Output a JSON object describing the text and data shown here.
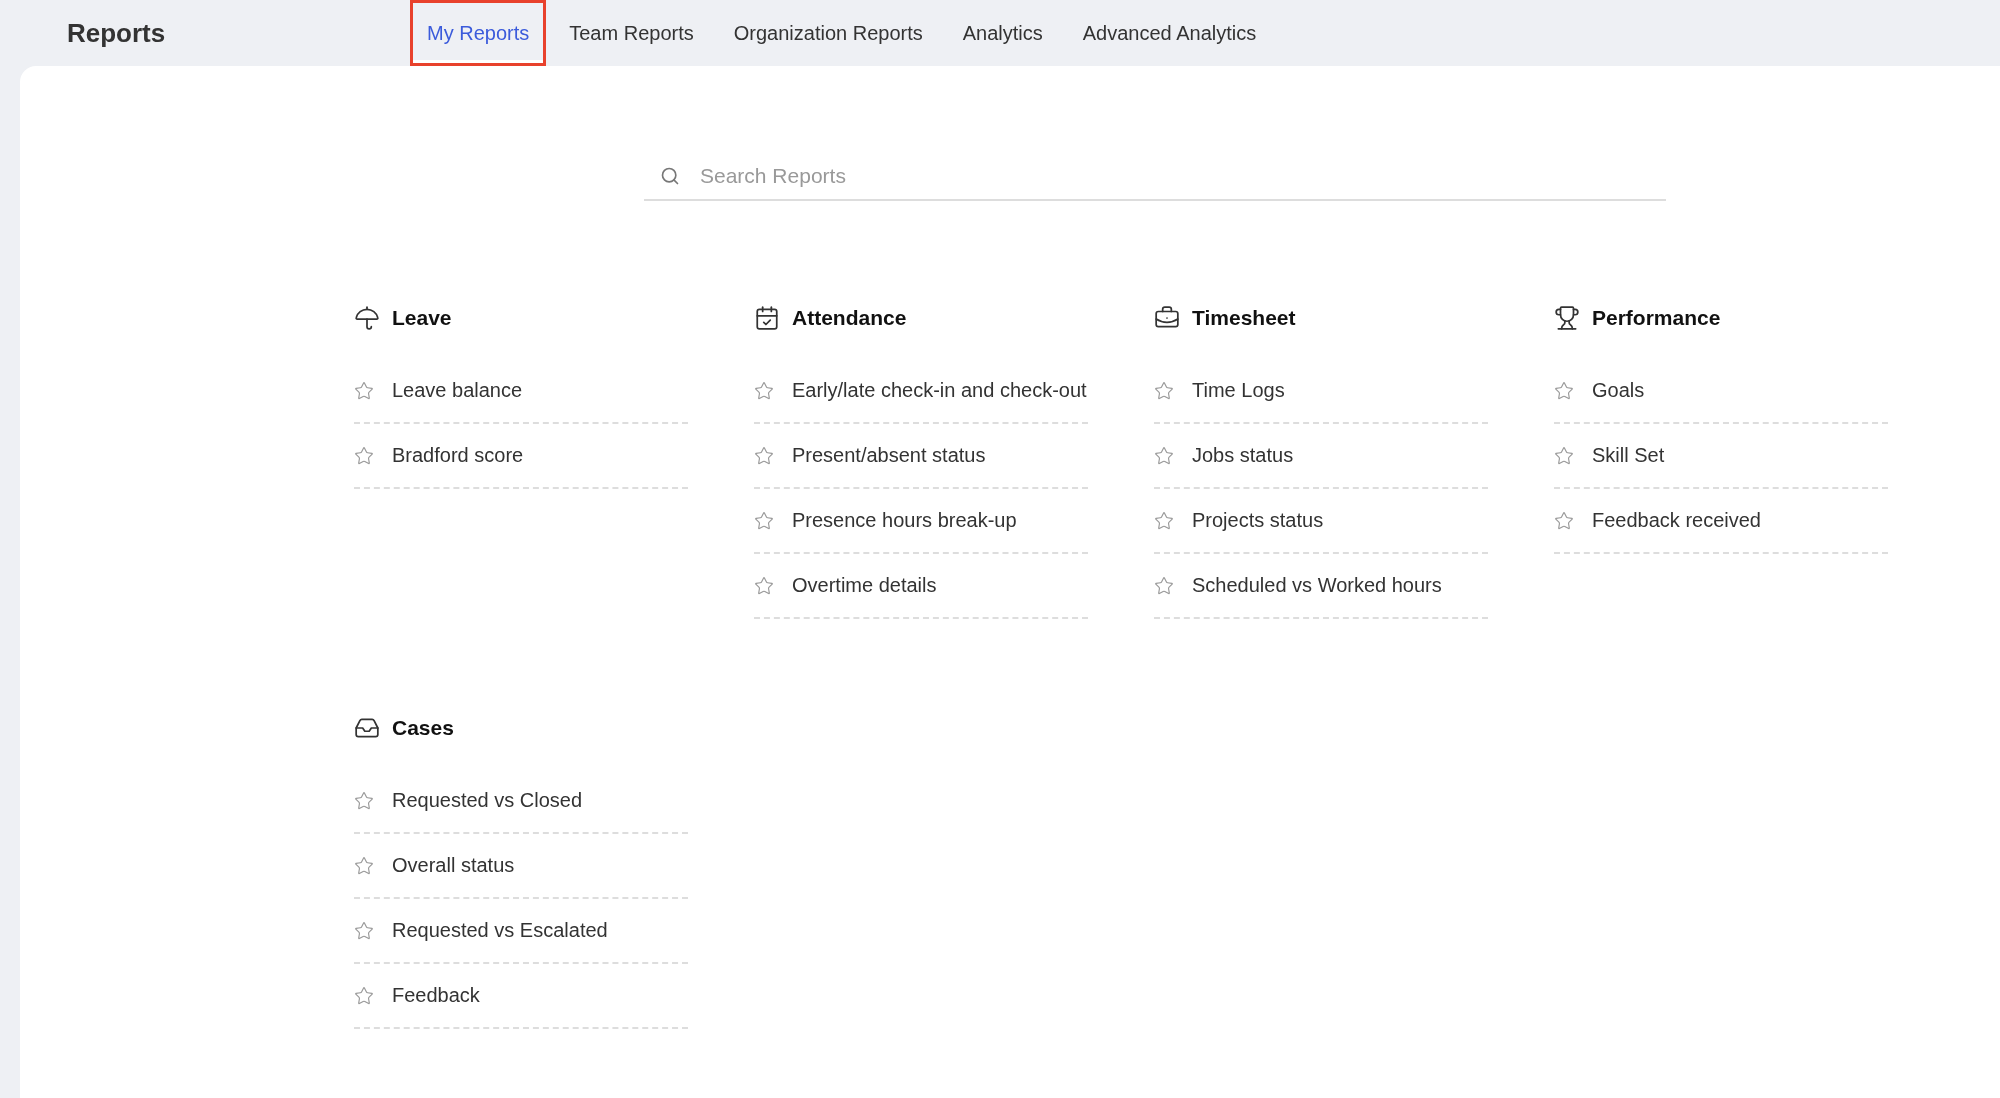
{
  "header": {
    "title": "Reports"
  },
  "tabs": [
    {
      "label": "My Reports",
      "selected": true
    },
    {
      "label": "Team Reports",
      "selected": false
    },
    {
      "label": "Organization Reports",
      "selected": false
    },
    {
      "label": "Analytics",
      "selected": false
    },
    {
      "label": "Advanced Analytics",
      "selected": false
    }
  ],
  "search": {
    "placeholder": "Search Reports"
  },
  "sections": [
    {
      "title": "Leave",
      "kind": "umbrella",
      "items": [
        "Leave balance",
        "Bradford score"
      ]
    },
    {
      "title": "Attendance",
      "kind": "calendar",
      "items": [
        "Early/late check-in and check-out",
        "Present/absent status",
        "Presence hours break-up",
        "Overtime details"
      ]
    },
    {
      "title": "Timesheet",
      "kind": "briefcase",
      "items": [
        "Time Logs",
        "Jobs status",
        "Projects status",
        "Scheduled vs Worked hours"
      ]
    },
    {
      "title": "Performance",
      "kind": "trophy",
      "items": [
        "Goals",
        "Skill Set",
        "Feedback received"
      ]
    },
    {
      "title": "Cases",
      "kind": "inbox",
      "items": [
        "Requested vs Closed",
        "Overall status",
        "Requested vs Escalated",
        "Feedback"
      ]
    }
  ]
}
